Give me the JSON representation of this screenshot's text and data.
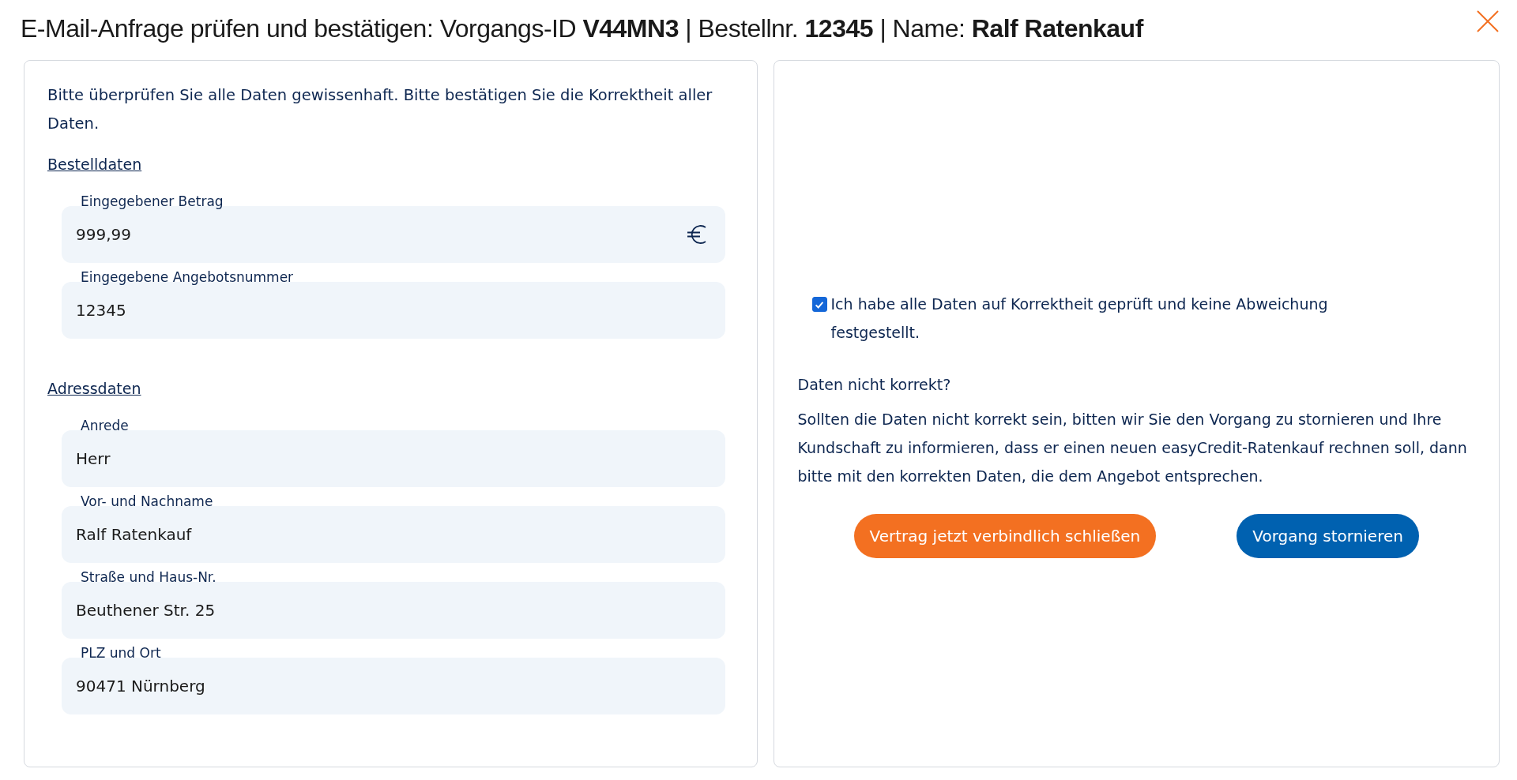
{
  "window": {
    "title": "E-Mail-Anfrage prüfen und bestätigen: Vorgangs-ID **V44MN3** | Bestellnr. **12345** | Name: **Ralf Ratenkauf**"
  },
  "left_panel": {
    "intro": "Bitte überprüfen Sie alle Daten gewissenhaft. Bitte bestätigen Sie die Korrektheit aller Daten.",
    "sections": [
      {
        "heading": "Bestelldaten",
        "fields": [
          {
            "label": "Eingegebener Betrag",
            "value": "999,99",
            "kind": "currency"
          },
          {
            "label": "Eingegebene Angebotsnummer",
            "value": "12345",
            "kind": "text"
          }
        ]
      },
      {
        "heading": "Adressdaten",
        "fields": [
          {
            "label": "Anrede",
            "value": "Herr",
            "kind": "text"
          },
          {
            "label": "Vor- und Nachname",
            "value": "Ralf Ratenkauf",
            "kind": "text"
          },
          {
            "label": "Straße und Haus-Nr.",
            "value": "Beuthener Str. 25",
            "kind": "text"
          },
          {
            "label": "PLZ und Ort",
            "value": "90471 Nürnberg",
            "kind": "text"
          }
        ]
      }
    ]
  },
  "right_panel": {
    "confirmation": {
      "label": "Ich habe alle Daten auf Korrektheit geprüft und keine Abweichung festgestellt.",
      "checked": true
    },
    "question": "Daten nicht korrekt?",
    "explanation": "Sollten die Daten nicht korrekt sein, bitten wir Sie den Vorgang zu stornieren und Ihre Kundschaft zu informieren, dass er einen neuen easyCredit-Ratenkauf rechnen soll, dann bitte mit den korrekten Daten, die dem Angebot entsprechen.",
    "buttons": [
      {
        "label": "Vertrag jetzt verbindlich schließen",
        "kind": "primary"
      },
      {
        "label": "Vorgang stornieren",
        "kind": "secondary"
      }
    ]
  }
}
